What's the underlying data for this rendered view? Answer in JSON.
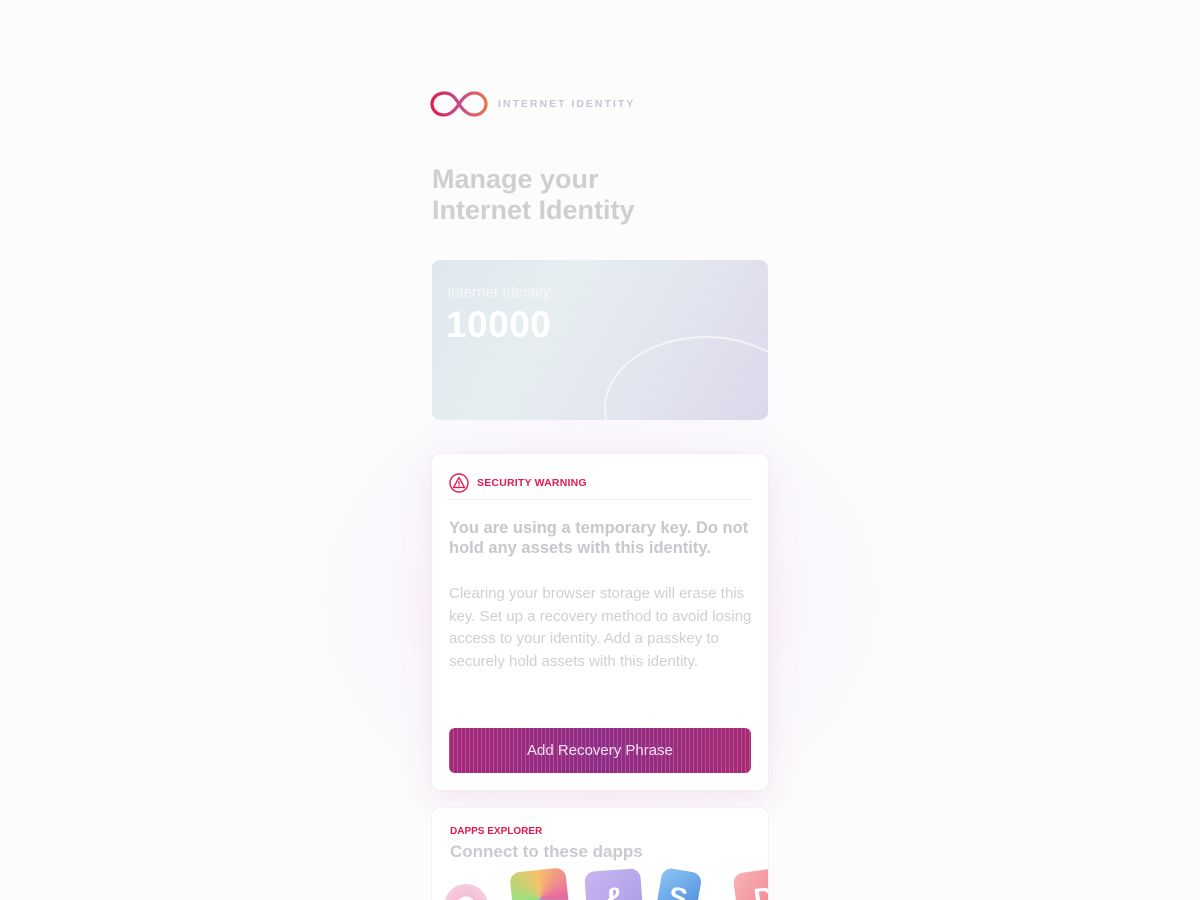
{
  "header": {
    "brand_text": "INTERNET IDENTITY",
    "logo_icon": "infinity-icon"
  },
  "page": {
    "title_line1": "Manage your",
    "title_line2": "Internet Identity"
  },
  "identity_card": {
    "label": "Internet Identity:",
    "anchor_number": "10000"
  },
  "security_warning": {
    "icon": "warning-triangle-icon",
    "tag": "SECURITY WARNING",
    "heading": "You are using a temporary key. Do not hold any assets with this identity.",
    "body": "Clearing your browser storage will erase this key. Set up a recovery method to avoid losing access to your identity. Add a passkey to securely hold assets with this identity.",
    "button_label": "Add Recovery Phrase"
  },
  "dapps_explorer": {
    "tag": "DAPPS EXPLORER",
    "title": "Connect to these dapps",
    "dapp_icons": [
      "dapp-logo",
      "dapp-logo",
      "dapp-logo",
      "dapp-logo",
      "dapp-logo"
    ]
  },
  "colors": {
    "accent": "#e21a4f",
    "button": "#8f2c86",
    "title_text": "#cfcfd3",
    "background": "#fcfcfd"
  }
}
